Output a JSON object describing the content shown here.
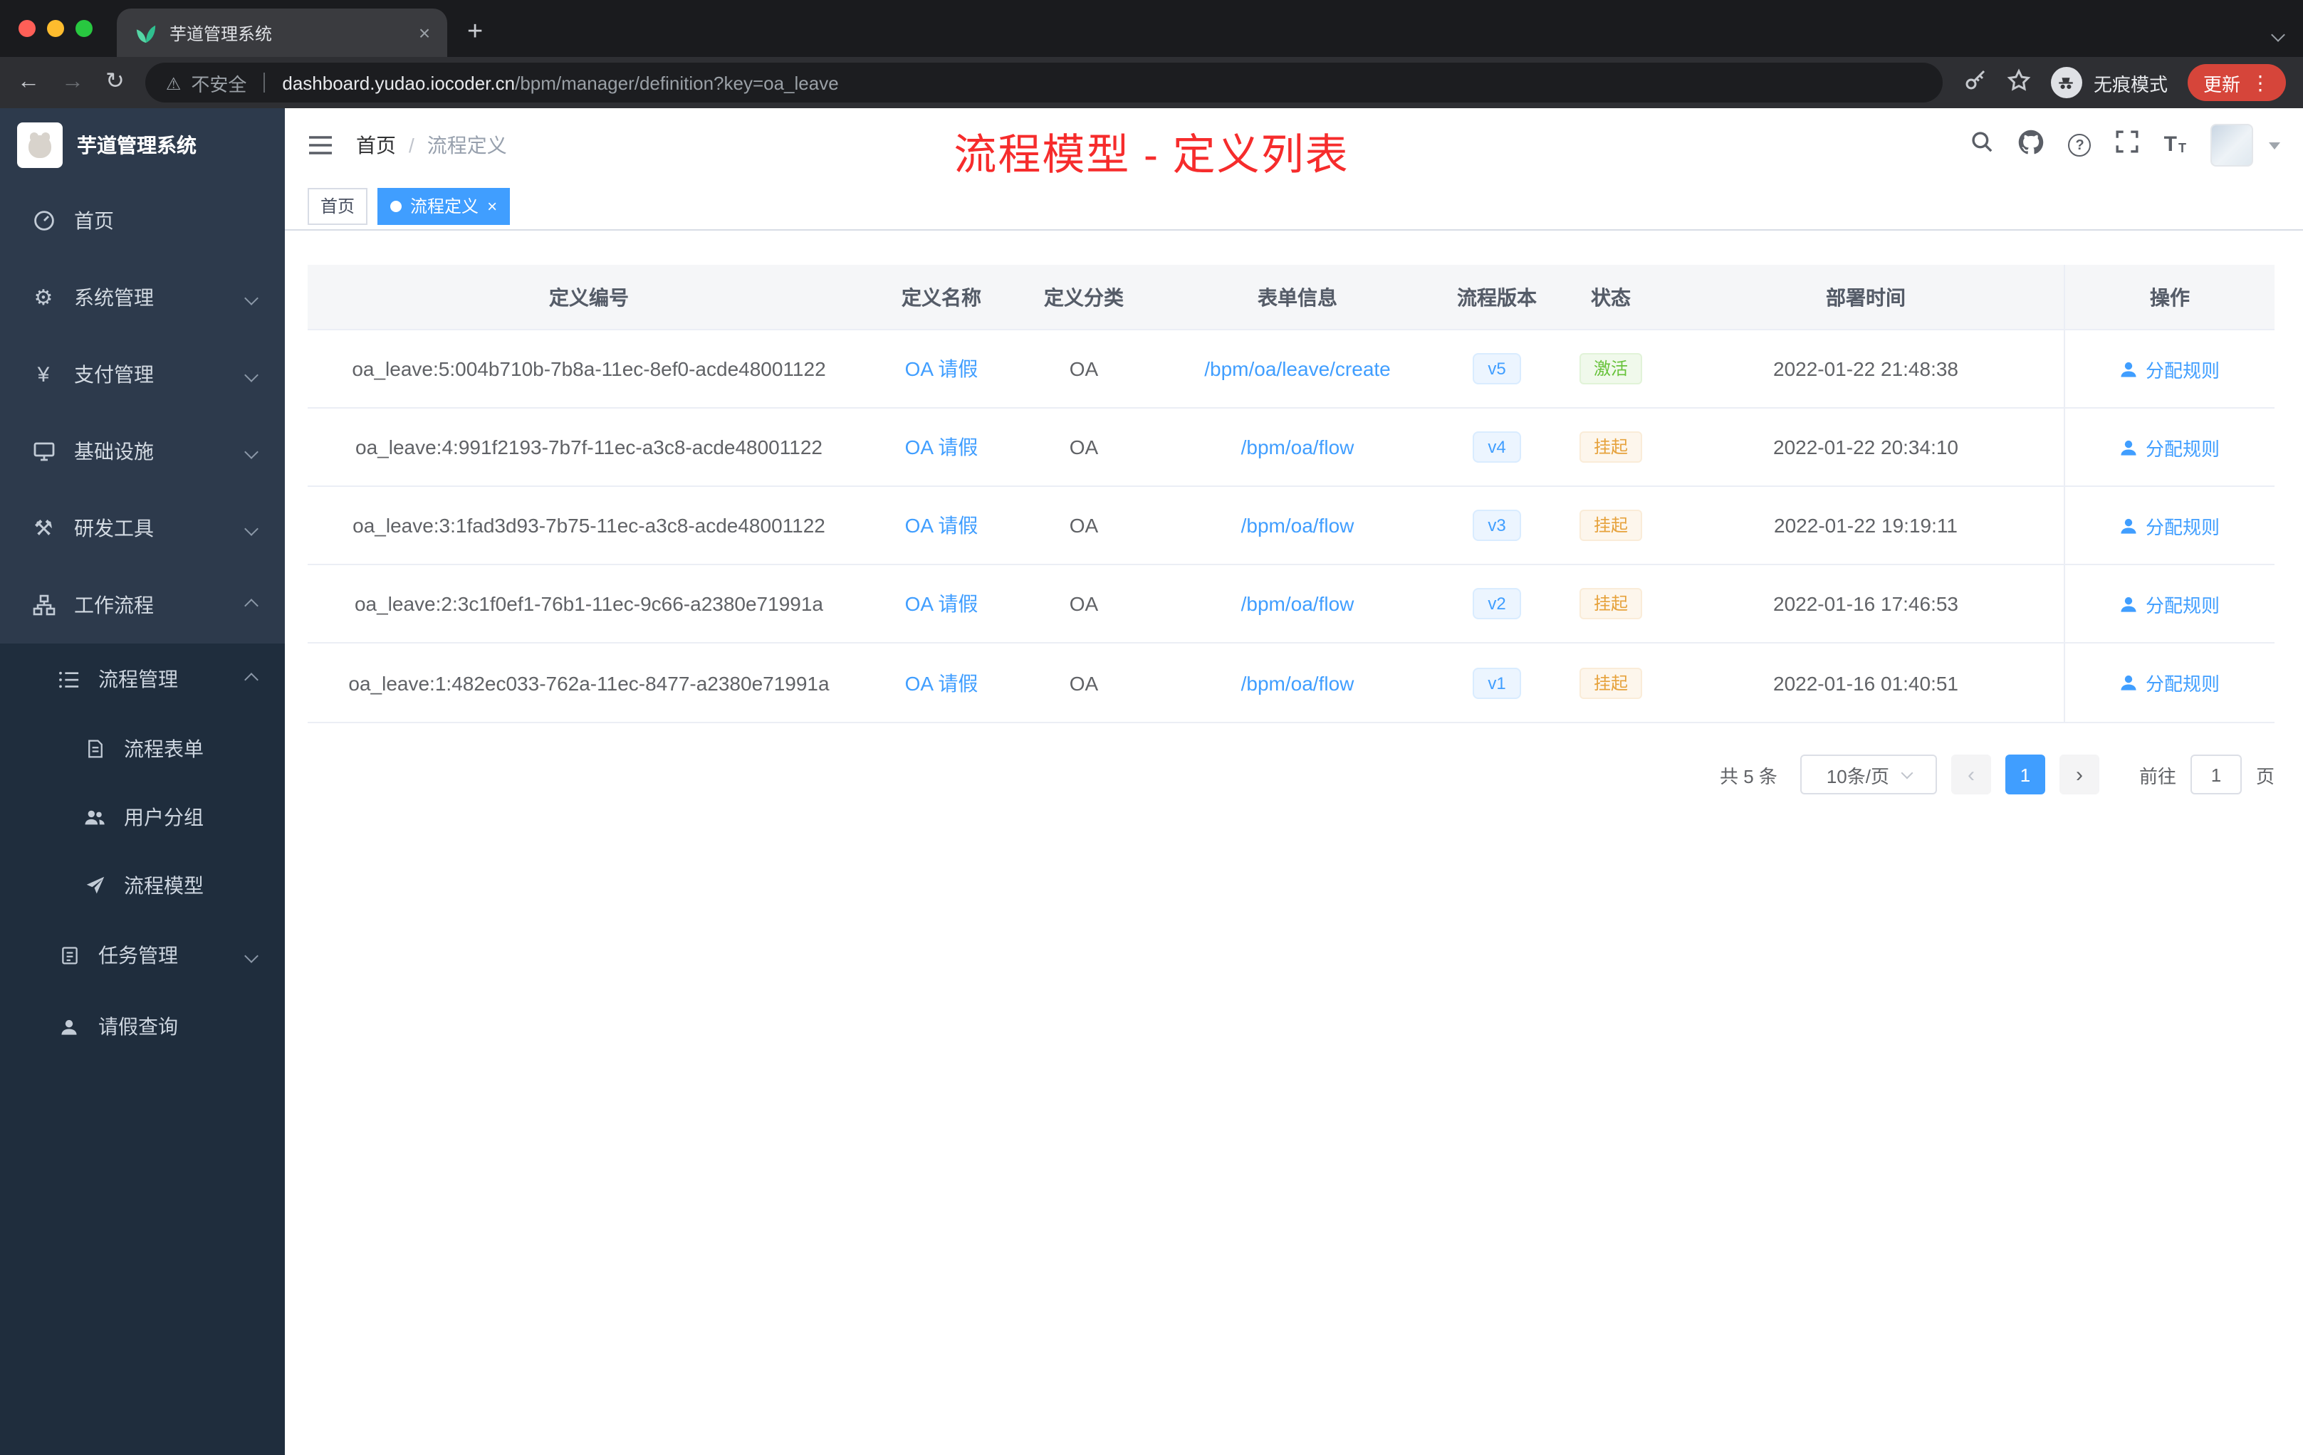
{
  "browser": {
    "tab_title": "芋道管理系统",
    "security_label": "不安全",
    "url_host": "dashboard.yudao.iocoder.cn",
    "url_path": "/bpm/manager/definition?key=oa_leave",
    "incognito_label": "无痕模式",
    "update_label": "更新"
  },
  "sidebar": {
    "logo_title": "芋道管理系统",
    "menu": [
      {
        "label": "首页"
      },
      {
        "label": "系统管理"
      },
      {
        "label": "支付管理"
      },
      {
        "label": "基础设施"
      },
      {
        "label": "研发工具"
      },
      {
        "label": "工作流程"
      }
    ],
    "submenu": [
      {
        "label": "流程管理"
      },
      {
        "label": "流程表单"
      },
      {
        "label": "用户分组"
      },
      {
        "label": "流程模型"
      },
      {
        "label": "任务管理"
      },
      {
        "label": "请假查询"
      }
    ]
  },
  "navbar": {
    "breadcrumb_home": "首页",
    "breadcrumb_sep": "/",
    "breadcrumb_current": "流程定义",
    "overlay_title": "流程模型 - 定义列表"
  },
  "tags": {
    "home": "首页",
    "current": "流程定义"
  },
  "table": {
    "columns": {
      "id": "定义编号",
      "name": "定义名称",
      "category": "定义分类",
      "form": "表单信息",
      "version": "流程版本",
      "status": "状态",
      "time": "部署时间",
      "action": "操作"
    },
    "rows": [
      {
        "id": "oa_leave:5:004b710b-7b8a-11ec-8ef0-acde48001122",
        "name": "OA 请假",
        "category": "OA",
        "form": "/bpm/oa/leave/create",
        "version": "v5",
        "status": "激活",
        "time": "2022-01-22 21:48:38",
        "action": "分配规则"
      },
      {
        "id": "oa_leave:4:991f2193-7b7f-11ec-a3c8-acde48001122",
        "name": "OA 请假",
        "category": "OA",
        "form": "/bpm/oa/flow",
        "version": "v4",
        "status": "挂起",
        "time": "2022-01-22 20:34:10",
        "action": "分配规则"
      },
      {
        "id": "oa_leave:3:1fad3d93-7b75-11ec-a3c8-acde48001122",
        "name": "OA 请假",
        "category": "OA",
        "form": "/bpm/oa/flow",
        "version": "v3",
        "status": "挂起",
        "time": "2022-01-22 19:19:11",
        "action": "分配规则"
      },
      {
        "id": "oa_leave:2:3c1f0ef1-76b1-11ec-9c66-a2380e71991a",
        "name": "OA 请假",
        "category": "OA",
        "form": "/bpm/oa/flow",
        "version": "v2",
        "status": "挂起",
        "time": "2022-01-16 17:46:53",
        "action": "分配规则"
      },
      {
        "id": "oa_leave:1:482ec033-762a-11ec-8477-a2380e71991a",
        "name": "OA 请假",
        "category": "OA",
        "form": "/bpm/oa/flow",
        "version": "v1",
        "status": "挂起",
        "time": "2022-01-16 01:40:51",
        "action": "分配规则"
      }
    ]
  },
  "pagination": {
    "total": "共 5 条",
    "page_size": "10条/页",
    "prev": "‹",
    "page": "1",
    "next": "›",
    "goto": "前往",
    "goto_value": "1",
    "unit": "页"
  },
  "colors": {
    "accent": "#409eff",
    "title_red": "#f62c2c",
    "success": "#67c23a",
    "warning": "#e6a23c",
    "sidebar": "#2d3a4c",
    "submenu": "#1f2d3d"
  }
}
